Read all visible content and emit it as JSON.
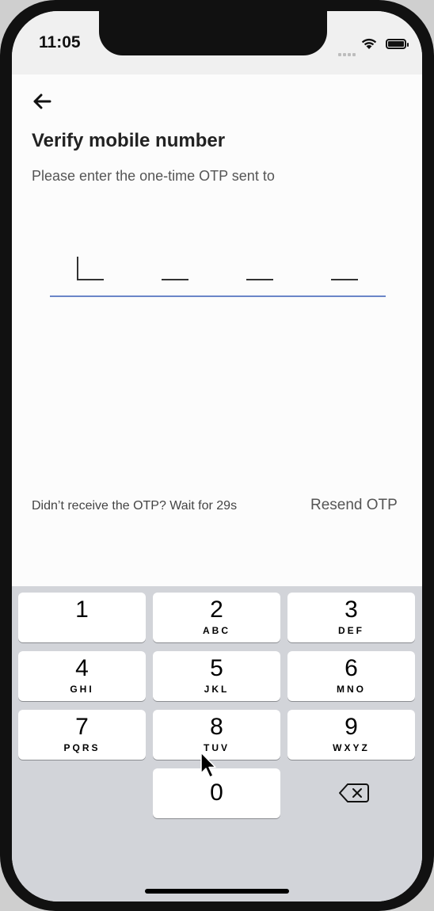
{
  "status": {
    "time": "11:05"
  },
  "header": {
    "title": "Verify mobile number",
    "subtitle": "Please enter the one-time OTP sent to"
  },
  "otp": {
    "length": 4,
    "value": ""
  },
  "resend": {
    "info": "Didn’t receive the OTP? Wait for 29s",
    "button": "Resend OTP"
  },
  "keypad": {
    "keys": [
      {
        "num": "1",
        "letters": ""
      },
      {
        "num": "2",
        "letters": "ABC"
      },
      {
        "num": "3",
        "letters": "DEF"
      },
      {
        "num": "4",
        "letters": "GHI"
      },
      {
        "num": "5",
        "letters": "JKL"
      },
      {
        "num": "6",
        "letters": "MNO"
      },
      {
        "num": "7",
        "letters": "PQRS"
      },
      {
        "num": "8",
        "letters": "TUV"
      },
      {
        "num": "9",
        "letters": "WXYZ"
      },
      {
        "num": "0",
        "letters": ""
      }
    ]
  },
  "icons": {
    "back": "arrow-left-icon",
    "delete": "backspace-icon",
    "wifi": "wifi-icon",
    "battery": "battery-icon",
    "signal": "signal-icon",
    "cursor": "mouse-cursor-icon"
  },
  "colors": {
    "accent_underline": "#6a86c8",
    "keyboard_bg": "#d2d4d9"
  }
}
